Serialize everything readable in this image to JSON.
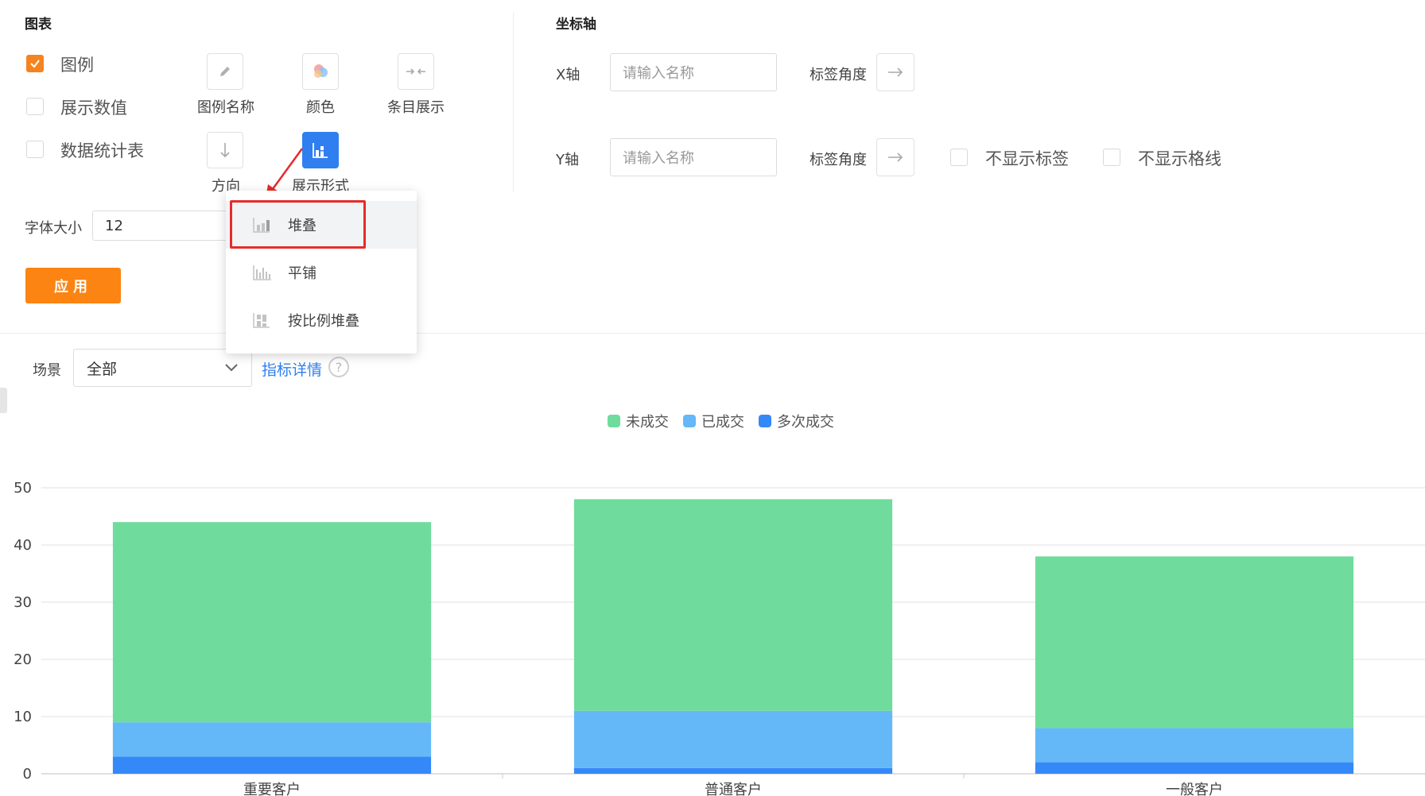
{
  "chart_section": {
    "title": "图表",
    "legend_checkbox": {
      "label": "图例",
      "checked": true
    },
    "show_values_checkbox": {
      "label": "展示数值",
      "checked": false
    },
    "data_table_checkbox": {
      "label": "数据统计表",
      "checked": false
    },
    "buttons": {
      "legend_name": "图例名称",
      "color": "颜色",
      "item_display": "条目展示",
      "direction": "方向",
      "display_form": "展示形式"
    },
    "font_size_label": "字体大小",
    "font_size_value": "12",
    "apply_label": "应用"
  },
  "axis_section": {
    "title": "坐标轴",
    "x_label": "X轴",
    "x_placeholder": "请输入名称",
    "y_label": "Y轴",
    "y_placeholder": "请输入名称",
    "tag_angle_label": "标签角度",
    "hide_labels": {
      "label": "不显示标签",
      "checked": false
    },
    "hide_gridlines": {
      "label": "不显示格线",
      "checked": false
    }
  },
  "display_form_menu": {
    "items": [
      {
        "label": "堆叠",
        "icon": "stacked-bar-icon",
        "active": true
      },
      {
        "label": "平铺",
        "icon": "grouped-bar-icon",
        "active": false
      },
      {
        "label": "按比例堆叠",
        "icon": "percent-stacked-bar-icon",
        "active": false
      }
    ]
  },
  "filter": {
    "scene_label": "场景",
    "scene_value": "全部",
    "metric_link": "指标详情",
    "help_glyph": "?"
  },
  "colors": {
    "accent_orange": "#fb8412",
    "primary_blue": "#2f7ff0",
    "highlight_red": "#e62b2b"
  },
  "chart_data": {
    "type": "bar",
    "stacked": true,
    "categories": [
      "重要客户",
      "普通客户",
      "一般客户"
    ],
    "series": [
      {
        "name": "多次成交",
        "color": "#3588f7",
        "values": [
          3,
          1,
          2
        ]
      },
      {
        "name": "已成交",
        "color": "#64b8f8",
        "values": [
          6,
          10,
          6
        ]
      },
      {
        "name": "未成交",
        "color": "#6fdb9c",
        "values": [
          35,
          37,
          30
        ]
      }
    ],
    "legend_order": [
      "未成交",
      "已成交",
      "多次成交"
    ],
    "yticks": [
      "0",
      "10",
      "20",
      "30",
      "40",
      "50"
    ],
    "ylim": [
      0,
      50
    ],
    "grid": true,
    "legend_position": "top-center"
  }
}
